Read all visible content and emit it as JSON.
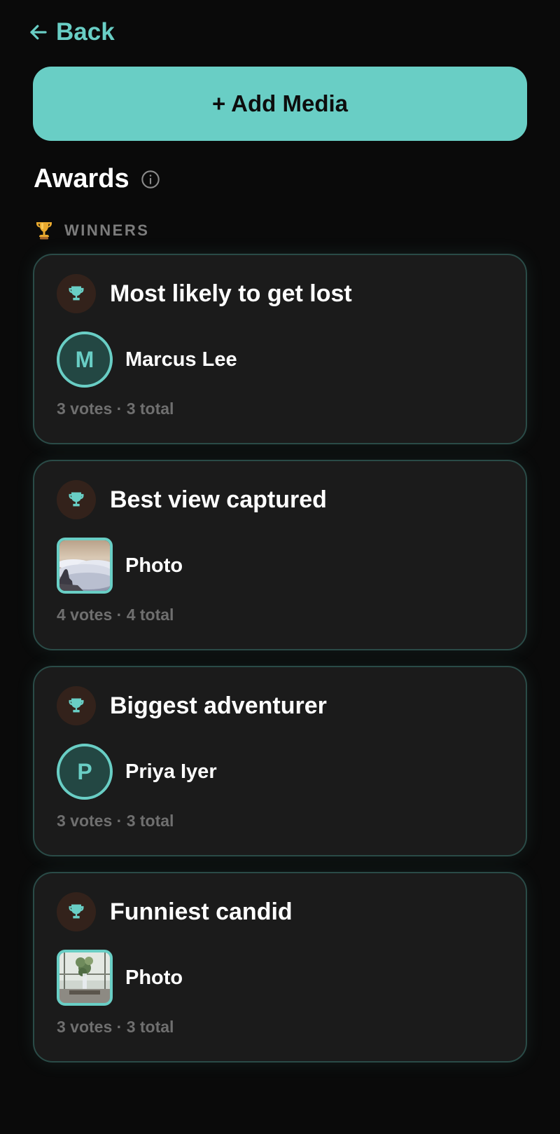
{
  "nav": {
    "back_label": "Back"
  },
  "actions": {
    "add_media_label": "+ Add Media"
  },
  "awards": {
    "title": "Awards",
    "section_label": "WINNERS",
    "cards": [
      {
        "title": "Most likely to get lost",
        "winner_type": "person",
        "initial": "M",
        "winner": "Marcus Lee",
        "votes": "3 votes · 3 total"
      },
      {
        "title": "Best view captured",
        "winner_type": "photo",
        "winner": "Photo",
        "votes": "4 votes · 4 total"
      },
      {
        "title": "Biggest adventurer",
        "winner_type": "person",
        "initial": "P",
        "winner": "Priya Iyer",
        "votes": "3 votes · 3 total"
      },
      {
        "title": "Funniest candid",
        "winner_type": "photo",
        "winner": "Photo",
        "votes": "3 votes · 3 total"
      }
    ]
  },
  "colors": {
    "accent": "#69cec5",
    "background": "#0a0a0a",
    "card": "#1b1b1b",
    "muted": "#6f6f6f"
  }
}
